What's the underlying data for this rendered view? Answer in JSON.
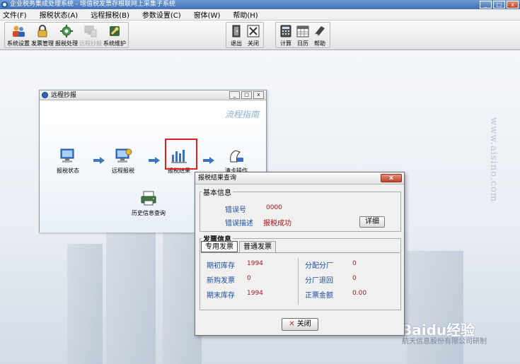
{
  "window": {
    "title": "企业税务集成处理系统 - 增值税发票存根联网上采集子系统",
    "buttons": {
      "minimize": "_",
      "maximize": "□",
      "close": "x"
    }
  },
  "menu": [
    "文件(F)",
    "报税状态(A)",
    "远程报税(B)",
    "参数设置(C)",
    "窗体(W)",
    "帮助(H)"
  ],
  "toolbar": {
    "group1": [
      "系统设置",
      "发票管理",
      "报税处理",
      "远程抄报",
      "系统维护"
    ],
    "group2": [
      "退出",
      "关闭"
    ],
    "group3": [
      "计算",
      "日历",
      "帮助"
    ]
  },
  "remote_window": {
    "title": "远程抄报",
    "buttons": {
      "minimize": "_",
      "maximize": "□",
      "close": "x"
    },
    "flow_guide": "流程指南",
    "steps": [
      "报税状态",
      "远程报税",
      "报税结果",
      "清卡操作"
    ],
    "history": "历史信息查询"
  },
  "dialog": {
    "title": "报税结果查询",
    "close_x": "x",
    "basic_legend": "基本信息",
    "error_code_label": "错误号",
    "error_code_value": "0000",
    "error_desc_label": "错误描述",
    "error_desc_value": "报税成功",
    "detail_button": "详细",
    "invoice_legend": "发票信息",
    "tabs": [
      "专用发票",
      "普通发票"
    ],
    "left_rows": [
      {
        "label": "期初库存",
        "value": "1994"
      },
      {
        "label": "新购发票",
        "value": "0"
      },
      {
        "label": "期末库存",
        "value": "1994"
      }
    ],
    "right_rows": [
      {
        "label": "分配分厂",
        "value": "0"
      },
      {
        "label": "分厂退回",
        "value": "0"
      },
      {
        "label": "正票金额",
        "value": "0.00"
      }
    ],
    "close_button": "关闭"
  },
  "desktop": {
    "watermark_url": "www.aisino.com",
    "company_mark": "航天信息股份有限公司研制",
    "baidu_mark": "Baidu经验"
  },
  "colors": {
    "accent_red": "#e0201d",
    "title_blue": "#3f6fb5"
  }
}
